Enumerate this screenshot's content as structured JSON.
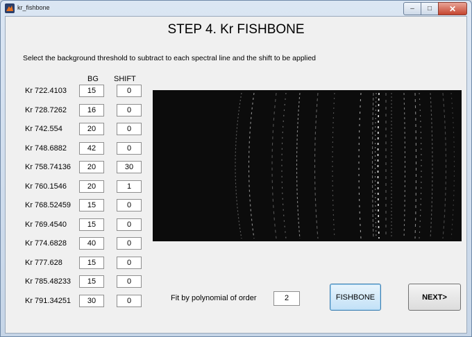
{
  "window": {
    "title": "kr_fishbone",
    "icon": "matlab-icon",
    "buttons": [
      "minimize",
      "maximize",
      "close"
    ]
  },
  "header": {
    "title": "STEP 4. Kr FISHBONE"
  },
  "instruction": "Select the background threshold to subtract to each spectral line and the shift to be applied",
  "columns": {
    "bg": "BG",
    "shift": "SHIFT"
  },
  "lines": [
    {
      "label": "Kr 722.4103",
      "bg": "15",
      "shift": "0"
    },
    {
      "label": "Kr 728.7262",
      "bg": "16",
      "shift": "0"
    },
    {
      "label": "Kr 742.554",
      "bg": "20",
      "shift": "0"
    },
    {
      "label": "Kr 748.6882",
      "bg": "42",
      "shift": "0"
    },
    {
      "label": "Kr 758.74136",
      "bg": "20",
      "shift": "30"
    },
    {
      "label": "Kr 760.1546",
      "bg": "20",
      "shift": "1"
    },
    {
      "label": "Kr 768.52459",
      "bg": "15",
      "shift": "0"
    },
    {
      "label": "Kr 769.4540",
      "bg": "15",
      "shift": "0"
    },
    {
      "label": "Kr 774.6828",
      "bg": "40",
      "shift": "0"
    },
    {
      "label": "Kr 777.628",
      "bg": "15",
      "shift": "0"
    },
    {
      "label": "Kr 785.48233",
      "bg": "15",
      "shift": "0"
    },
    {
      "label": "Kr 791.34251",
      "bg": "30",
      "shift": "0"
    }
  ],
  "fit": {
    "label": "Fit by polynomial of order",
    "order": "2"
  },
  "buttons": {
    "fishbone": "FISHBONE",
    "next": "NEXT>"
  },
  "colors": {
    "spectrum_bg": "#0c0c0c",
    "primary_button": "#c2e1f7"
  }
}
